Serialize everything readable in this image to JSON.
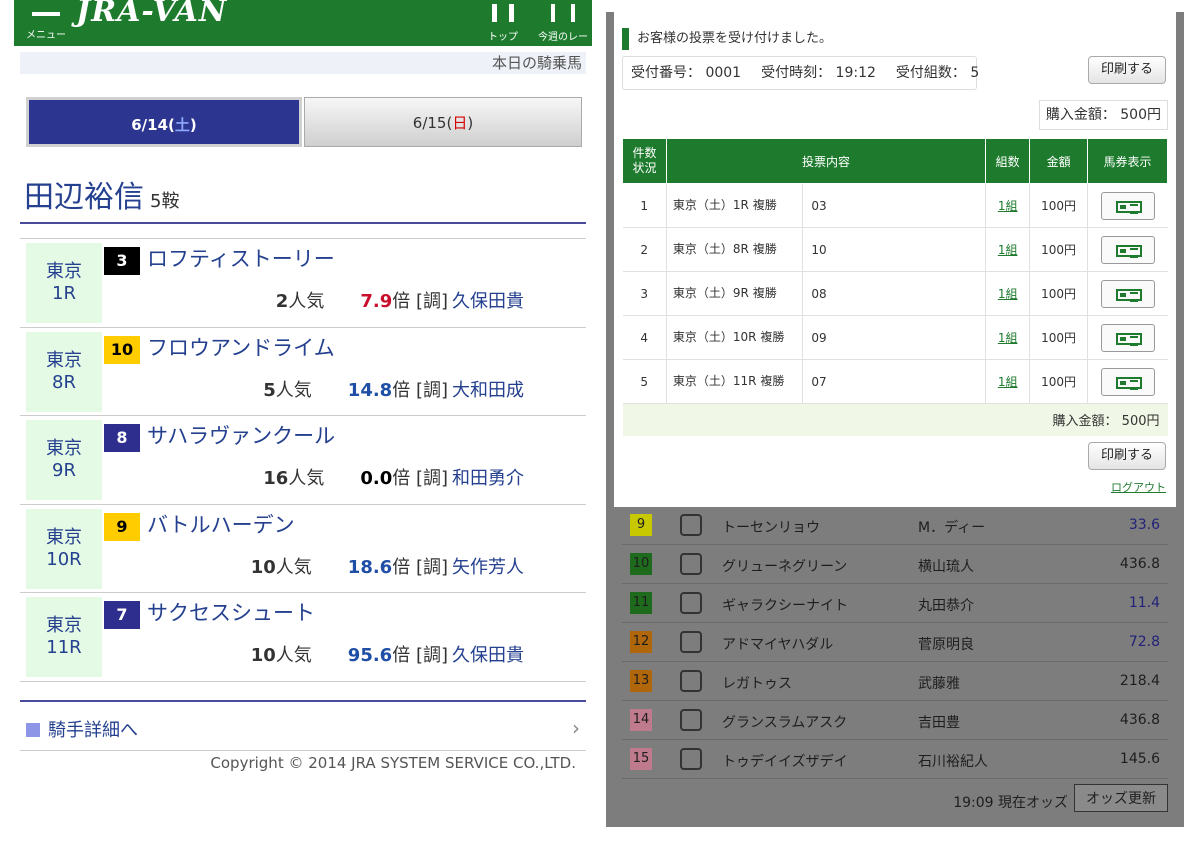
{
  "left": {
    "header": {
      "menu_label": "メニュー",
      "logo_text": "JRA-VAN",
      "nav": [
        {
          "label": "トップ"
        },
        {
          "label": "今週のレース"
        }
      ]
    },
    "subheader": "本日の騎乗馬",
    "day_tabs": [
      {
        "date": "6/14",
        "day": "土"
      },
      {
        "date": "6/15",
        "day": "日"
      }
    ],
    "jockey": {
      "name": "田辺裕信",
      "rides": "5鞍"
    },
    "races": [
      {
        "venue": "東京",
        "race": "1R",
        "num": "3",
        "num_bg": "#000000",
        "num_fg": "#ffffff",
        "horse": "ロフティストーリー",
        "pop_num": "2",
        "pop_unit": "人気",
        "odds_val": "7.9",
        "odds_color": "#c8102e",
        "odds_unit": "倍",
        "trainer_tag": "[調]",
        "trainer": "久保田貴"
      },
      {
        "venue": "東京",
        "race": "8R",
        "num": "10",
        "num_bg": "#ffcc00",
        "num_fg": "#000000",
        "horse": "フロウアンドライム",
        "pop_num": "5",
        "pop_unit": "人気",
        "odds_val": "14.8",
        "odds_color": "#1f4ea6",
        "odds_unit": "倍",
        "trainer_tag": "[調]",
        "trainer": "大和田成"
      },
      {
        "venue": "東京",
        "race": "9R",
        "num": "8",
        "num_bg": "#2e2e8f",
        "num_fg": "#ffffff",
        "horse": "サハラヴァンクール",
        "pop_num": "16",
        "pop_unit": "人気",
        "odds_val": "0.0",
        "odds_color": "#000000",
        "odds_unit": "倍",
        "trainer_tag": "[調]",
        "trainer": "和田勇介"
      },
      {
        "venue": "東京",
        "race": "10R",
        "num": "9",
        "num_bg": "#ffcc00",
        "num_fg": "#000000",
        "horse": "バトルハーデン",
        "pop_num": "10",
        "pop_unit": "人気",
        "odds_val": "18.6",
        "odds_color": "#1f4ea6",
        "odds_unit": "倍",
        "trainer_tag": "[調]",
        "trainer": "矢作芳人"
      },
      {
        "venue": "東京",
        "race": "11R",
        "num": "7",
        "num_bg": "#2e2e8f",
        "num_fg": "#ffffff",
        "horse": "サクセスシュート",
        "pop_num": "10",
        "pop_unit": "人気",
        "odds_val": "95.6",
        "odds_color": "#1f4ea6",
        "odds_unit": "倍",
        "trainer_tag": "[調]",
        "trainer": "久保田貴"
      }
    ],
    "detail_link": "騎手詳細へ",
    "copyright": "Copyright © 2014 JRA SYSTEM SERVICE CO.,LTD."
  },
  "right": {
    "modal": {
      "message": "お客様の投票を受け付けました。",
      "receipt_no": "受付番号： 0001",
      "receipt_time": "受付時刻： 19:12",
      "receipt_count": "受付組数： 5",
      "print_label": "印刷する",
      "total_label": "購入金額： 500円",
      "headers": [
        "件数状況",
        "投票内容",
        "組数",
        "金額",
        "馬券表示"
      ],
      "header_status_lines": [
        "件数",
        "状況"
      ],
      "rows": [
        {
          "no": "1",
          "content": "東京（土）1R 複勝",
          "horse": "03",
          "kumi": "1組",
          "amount": "100円"
        },
        {
          "no": "2",
          "content": "東京（土）8R 複勝",
          "horse": "10",
          "kumi": "1組",
          "amount": "100円"
        },
        {
          "no": "3",
          "content": "東京（土）9R 複勝",
          "horse": "08",
          "kumi": "1組",
          "amount": "100円"
        },
        {
          "no": "4",
          "content": "東京（土）10R 複勝",
          "horse": "09",
          "kumi": "1組",
          "amount": "100円"
        },
        {
          "no": "5",
          "content": "東京（土）11R 複勝",
          "horse": "07",
          "kumi": "1組",
          "amount": "100円"
        }
      ],
      "sum_label": "購入金額： 500円",
      "print_label_2": "印刷する",
      "logout_label": "ログアウト"
    },
    "odds": [
      {
        "no": "9",
        "no_bg": "#c8c800",
        "name": "トーセンリョウ",
        "jockey": "M．ディー",
        "odds": "33.6",
        "blue": true
      },
      {
        "no": "10",
        "no_bg": "#1e6b1e",
        "name": "グリューネグリーン",
        "jockey": "横山琉人",
        "odds": "436.8",
        "blue": false
      },
      {
        "no": "11",
        "no_bg": "#1e6b1e",
        "name": "ギャラクシーナイト",
        "jockey": "丸田恭介",
        "odds": "11.4",
        "blue": true
      },
      {
        "no": "12",
        "no_bg": "#b0660a",
        "name": "アドマイヤハダル",
        "jockey": "菅原明良",
        "odds": "72.8",
        "blue": true
      },
      {
        "no": "13",
        "no_bg": "#b0660a",
        "name": "レガトゥス",
        "jockey": "武藤雅",
        "odds": "218.4",
        "blue": false
      },
      {
        "no": "14",
        "no_bg": "#c07a8e",
        "name": "グランスラムアスク",
        "jockey": "吉田豊",
        "odds": "436.8",
        "blue": false
      },
      {
        "no": "15",
        "no_bg": "#c07a8e",
        "name": "トゥデイイズザデイ",
        "jockey": "石川裕紀人",
        "odds": "145.6",
        "blue": false
      }
    ],
    "odds_time": "19:09 現在オッズ",
    "odds_update": "オッズ更新"
  }
}
